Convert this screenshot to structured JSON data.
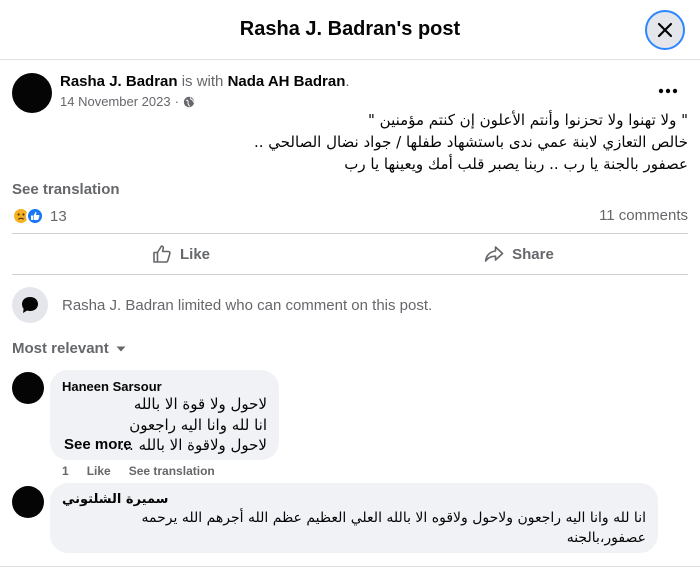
{
  "header": {
    "title": "Rasha J. Badran's post"
  },
  "post": {
    "author": "Rasha J. Badran",
    "with_text": " is with ",
    "tagged": "Nada AH Badran",
    "period": ".",
    "date": "14 November 2023",
    "separator": "·",
    "privacy_icon": "globe-icon",
    "text_lines": [
      "\" ولا تهنوا ولا تحزنوا وأنتم الأعلون إن كنتم مؤمنين \"",
      "خالص التعازي لابنة عمي ندى باستشهاد طفلها / جواد نضال الصالحي ..",
      "عصفور بالجنة يا رب .. ربنا يصبر قلب أمك ويعينها يا رب"
    ],
    "see_translation": "See translation",
    "reaction_count": "13",
    "reaction_icons": [
      "sad-face-icon",
      "like-icon"
    ],
    "comments_count": "11 comments",
    "actions": {
      "like": "Like",
      "share": "Share"
    },
    "limited_notice": "Rasha J. Badran limited who can comment on this post.",
    "sort_label": "Most relevant"
  },
  "comments": [
    {
      "name": "Haneen Sarsour",
      "lines": [
        "لاحول ولا قوة الا بالله",
        "انا لله وانا اليه راجعون",
        "لاحول ولاقوة الا بالله ..."
      ],
      "see_more": "See more",
      "meta": {
        "time": "1",
        "like": "Like",
        "translate": "See translation"
      }
    },
    {
      "name": "سميرة الشلتوني",
      "lines": [
        "انا لله وانا اليه راجعون ولاحول ولاقوه الا بالله العلي العظيم عظم الله أجرهم الله يرحمه",
        "عصفور،بالجنه"
      ]
    }
  ]
}
